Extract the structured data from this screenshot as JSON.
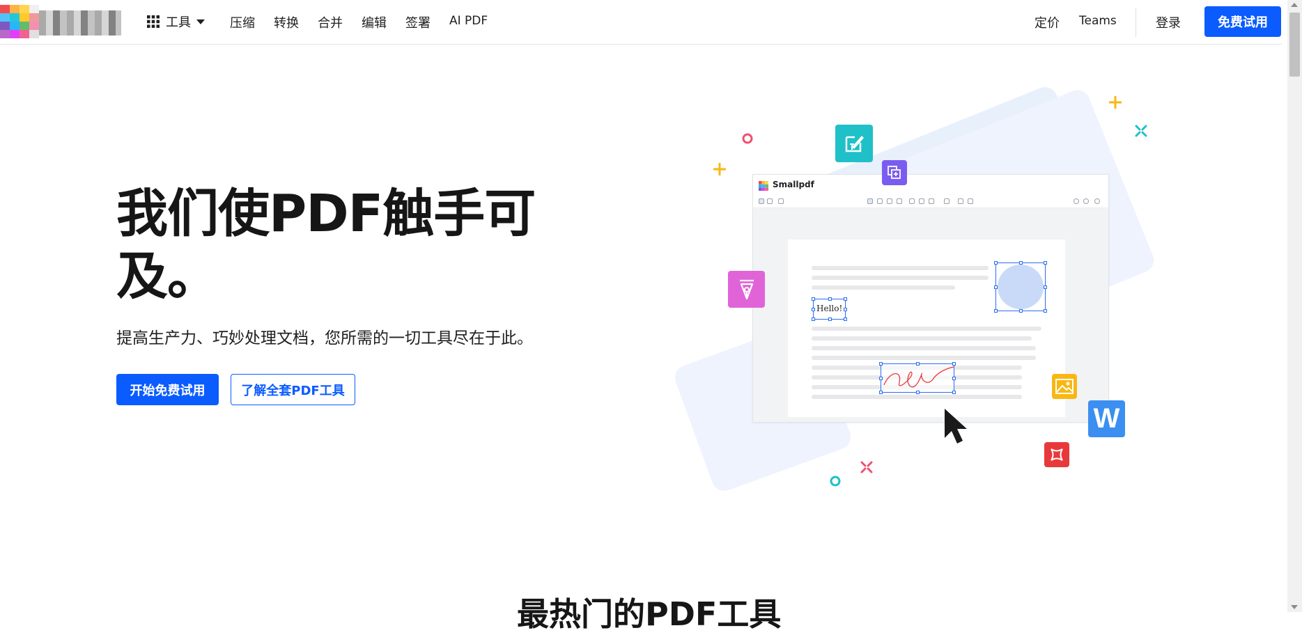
{
  "header": {
    "tools_label": "工具",
    "nav": [
      "压缩",
      "转换",
      "合并",
      "编辑",
      "签署",
      "AI PDF"
    ],
    "pricing": "定价",
    "teams": "Teams",
    "login": "登录",
    "cta": "免费试用"
  },
  "hero": {
    "title": "我们使PDF触手可及。",
    "subtitle": "提高生产力、巧妙处理文档，您所需的一切工具尽在于此。",
    "primary_button": "开始免费试用",
    "secondary_button": "了解全套PDF工具"
  },
  "illustration": {
    "app_name": "Smallpdf",
    "hello_text": "Hello!",
    "word_letter": "W"
  },
  "next_section": {
    "heading": "最热门的PDF工具"
  },
  "colors": {
    "primary": "#0b5cff",
    "teal": "#1fc0c8",
    "purple": "#7b5cf0",
    "pink": "#e064d8",
    "yellow": "#f9b712",
    "word_blue": "#3b8ff0",
    "red": "#e8393a"
  }
}
